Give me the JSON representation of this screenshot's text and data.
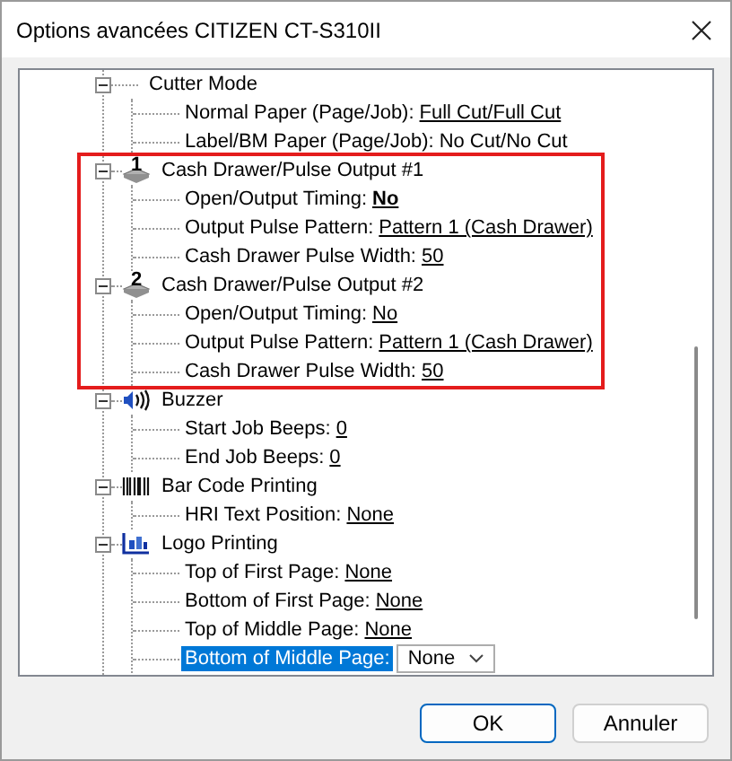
{
  "window": {
    "title": "Options avancées CITIZEN CT-S310II"
  },
  "sections": [
    {
      "highlighted": false,
      "groups": [
        {
          "kind": "plain",
          "label": "Cutter Mode",
          "expanded": true,
          "settings": [
            {
              "label": "Normal Paper (Page/Job):",
              "value": "Full Cut/Full Cut",
              "underlined": true,
              "bold": false,
              "selected": false
            },
            {
              "label": "Label/BM Paper (Page/Job):",
              "value": "No Cut/No Cut",
              "underlined": false,
              "bold": false,
              "selected": false
            }
          ]
        }
      ]
    },
    {
      "highlighted": true,
      "groups": [
        {
          "kind": "drawer",
          "badge": "1",
          "label": "Cash Drawer/Pulse Output #1",
          "expanded": true,
          "settings": [
            {
              "label": "Open/Output Timing:",
              "value": "No",
              "underlined": true,
              "bold": true,
              "selected": false
            },
            {
              "label": "Output Pulse Pattern:",
              "value": "Pattern 1 (Cash Drawer)",
              "underlined": true,
              "bold": false,
              "selected": false
            },
            {
              "label": "Cash Drawer Pulse Width:",
              "value": "50",
              "underlined": true,
              "bold": false,
              "selected": false
            }
          ]
        },
        {
          "kind": "drawer",
          "badge": "2",
          "label": "Cash Drawer/Pulse Output #2",
          "expanded": true,
          "settings": [
            {
              "label": "Open/Output Timing:",
              "value": "No",
              "underlined": true,
              "bold": false,
              "selected": false
            },
            {
              "label": "Output Pulse Pattern:",
              "value": "Pattern 1 (Cash Drawer)",
              "underlined": true,
              "bold": false,
              "selected": false
            },
            {
              "label": "Cash Drawer Pulse Width:",
              "value": "50",
              "underlined": true,
              "bold": false,
              "selected": false
            }
          ]
        }
      ]
    },
    {
      "highlighted": false,
      "groups": [
        {
          "kind": "buzzer",
          "label": "Buzzer",
          "expanded": true,
          "settings": [
            {
              "label": "Start Job Beeps:",
              "value": "0",
              "underlined": true,
              "bold": false,
              "selected": false
            },
            {
              "label": "End Job Beeps:",
              "value": "0",
              "underlined": true,
              "bold": false,
              "selected": false
            }
          ]
        },
        {
          "kind": "barcode",
          "label": "Bar Code Printing",
          "expanded": true,
          "settings": [
            {
              "label": "HRI Text Position:",
              "value": "None",
              "underlined": true,
              "bold": false,
              "selected": false
            }
          ]
        },
        {
          "kind": "logo",
          "label": "Logo Printing",
          "expanded": true,
          "settings": [
            {
              "label": "Top of First Page:",
              "value": "None",
              "underlined": true,
              "bold": false,
              "selected": false
            },
            {
              "label": "Bottom of First Page:",
              "value": "None",
              "underlined": true,
              "bold": false,
              "selected": false
            },
            {
              "label": "Top of Middle Page:",
              "value": "None",
              "underlined": true,
              "bold": false,
              "selected": false
            },
            {
              "label": "Bottom of Middle Page:",
              "value": "None",
              "underlined": false,
              "bold": false,
              "selected": true
            }
          ]
        }
      ]
    }
  ],
  "buttons": [
    {
      "label": "OK",
      "default": true
    },
    {
      "label": "Annuler",
      "default": false
    }
  ]
}
